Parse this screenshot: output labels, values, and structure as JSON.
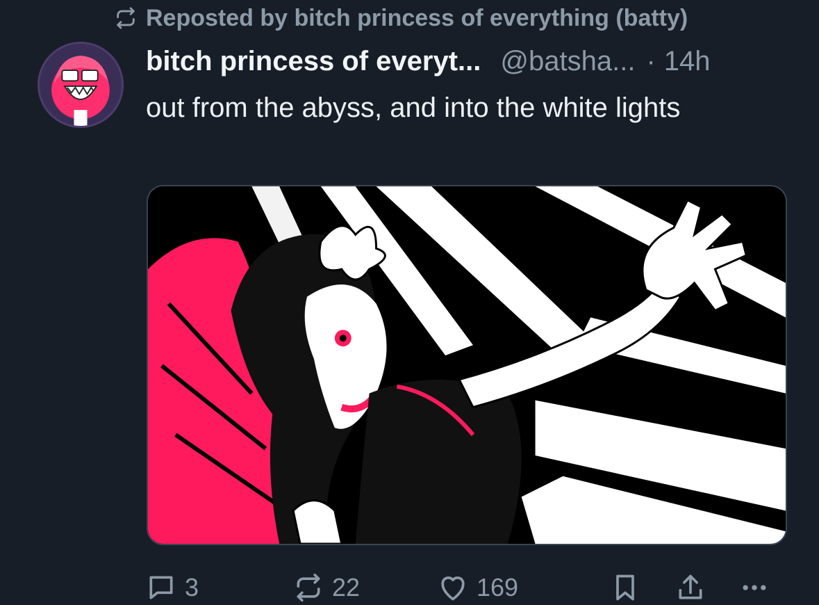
{
  "repost": {
    "label": "Reposted by bitch princess of everything (batty)",
    "icon": "repost-icon"
  },
  "post": {
    "display_name": "bitch princess of everyt...",
    "handle": "@batsha...",
    "separator": "·",
    "time": "14h",
    "text": "out from the abyss, and into the white lights",
    "avatar_icon": "avatar",
    "image_icon": "illustration-image"
  },
  "actions": {
    "reply_count": "3",
    "repost_count": "22",
    "like_count": "169",
    "icons": [
      "reply-icon",
      "repost-icon",
      "like-icon",
      "bookmark-icon",
      "share-icon",
      "more-icon"
    ]
  },
  "colors": {
    "background": "#171e27",
    "muted": "#8d9aa7",
    "text": "#eef2f6",
    "accent_pink": "#ff1a5e"
  }
}
